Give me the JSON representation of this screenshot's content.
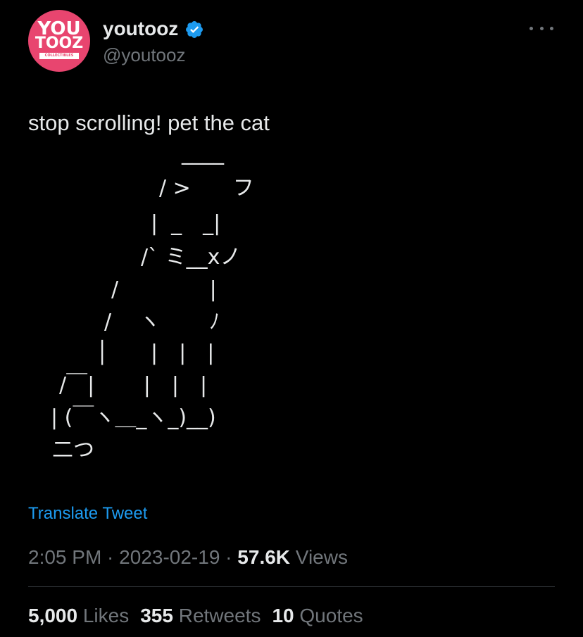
{
  "author": {
    "name": "youtooz",
    "handle": "@youtooz",
    "avatar_text_top": "YOU",
    "avatar_text_bottom": "TOOZ",
    "avatar_strip_text": "COLLECTIBLES",
    "avatar_color": "#e8456f",
    "verified_icon": "verified-badge-icon",
    "verified_color": "#1d9bf0"
  },
  "tweet": {
    "text": "stop scrolling! pet the cat",
    "ascii_art": [
      "____",
      "/ >　　フ",
      "|  _　_|",
      "/` ミ__xノ",
      "/　　　　 |",
      "/　 ヽ　　 ﾉ",
      "│　　|　|　|",
      "/￣|　　 |　|　|",
      "| (￣ヽ＿_ヽ_)__)",
      "二つ"
    ],
    "translate_label": "Translate Tweet"
  },
  "meta": {
    "time": "2:05 PM",
    "separator": " · ",
    "date": "2023-02-19",
    "views_count": "57.6K",
    "views_label": " Views"
  },
  "stats": {
    "likes_count": "5,000",
    "likes_label": " Likes",
    "retweets_count": "355",
    "retweets_label": " Retweets",
    "quotes_count": "10",
    "quotes_label": " Quotes"
  },
  "colors": {
    "background": "#000000",
    "text": "#e7e9ea",
    "secondary": "#71767b",
    "link": "#1d9bf0",
    "divider": "#2f3336"
  }
}
